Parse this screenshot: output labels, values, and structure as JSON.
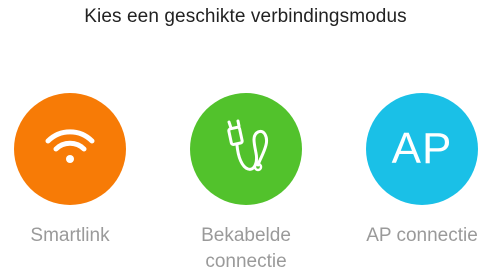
{
  "header": {
    "title": "Kies een geschikte verbindingsmodus"
  },
  "modes": [
    {
      "icon": "wifi-icon",
      "label": "Smartlink",
      "color": "#f77b06"
    },
    {
      "icon": "cable-icon",
      "label_line1": "Bekabelde",
      "label_line2": "connectie",
      "color": "#52c22c"
    },
    {
      "icon_text": "AP",
      "label": "AP connectie",
      "color": "#1ac0e7"
    }
  ]
}
